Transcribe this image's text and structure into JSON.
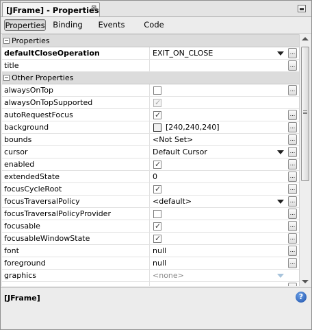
{
  "window": {
    "title": "[JFrame] - Properties",
    "close_glyph": "⊠"
  },
  "tabs": [
    {
      "label": "Properties",
      "active": true
    },
    {
      "label": "Binding",
      "active": false
    },
    {
      "label": "Events",
      "active": false
    },
    {
      "label": "Code",
      "active": false
    }
  ],
  "categories": {
    "properties": "Properties",
    "other": "Other Properties"
  },
  "rows": [
    {
      "name": "defaultCloseOperation",
      "value": "EXIT_ON_CLOSE"
    },
    {
      "name": "title",
      "value": ""
    },
    {
      "name": "alwaysOnTop",
      "checked": false
    },
    {
      "name": "alwaysOnTopSupported",
      "checked": true
    },
    {
      "name": "autoRequestFocus",
      "checked": true
    },
    {
      "name": "background",
      "value": "[240,240,240]"
    },
    {
      "name": "bounds",
      "value": "<Not Set>"
    },
    {
      "name": "cursor",
      "value": "Default Cursor"
    },
    {
      "name": "enabled",
      "checked": true
    },
    {
      "name": "extendedState",
      "value": "0"
    },
    {
      "name": "focusCycleRoot",
      "checked": true
    },
    {
      "name": "focusTraversalPolicy",
      "value": "<default>"
    },
    {
      "name": "focusTraversalPolicyProvider",
      "checked": false
    },
    {
      "name": "focusable",
      "checked": true
    },
    {
      "name": "focusableWindowState",
      "checked": true
    },
    {
      "name": "font",
      "value": "null"
    },
    {
      "name": "foreground",
      "value": "null"
    },
    {
      "name": "graphics",
      "value": "<none>"
    }
  ],
  "ellipsis": "...",
  "description": {
    "title": "[JFrame]",
    "help_glyph": "?"
  },
  "colors": {
    "background_swatch": "#f0f0f0",
    "help_icon": "#1c4fa8",
    "category_band": "#dcdcdc"
  },
  "icons": {
    "minimize": "minimize-icon",
    "help": "help-icon",
    "dropdown": "chevron-down-icon"
  }
}
